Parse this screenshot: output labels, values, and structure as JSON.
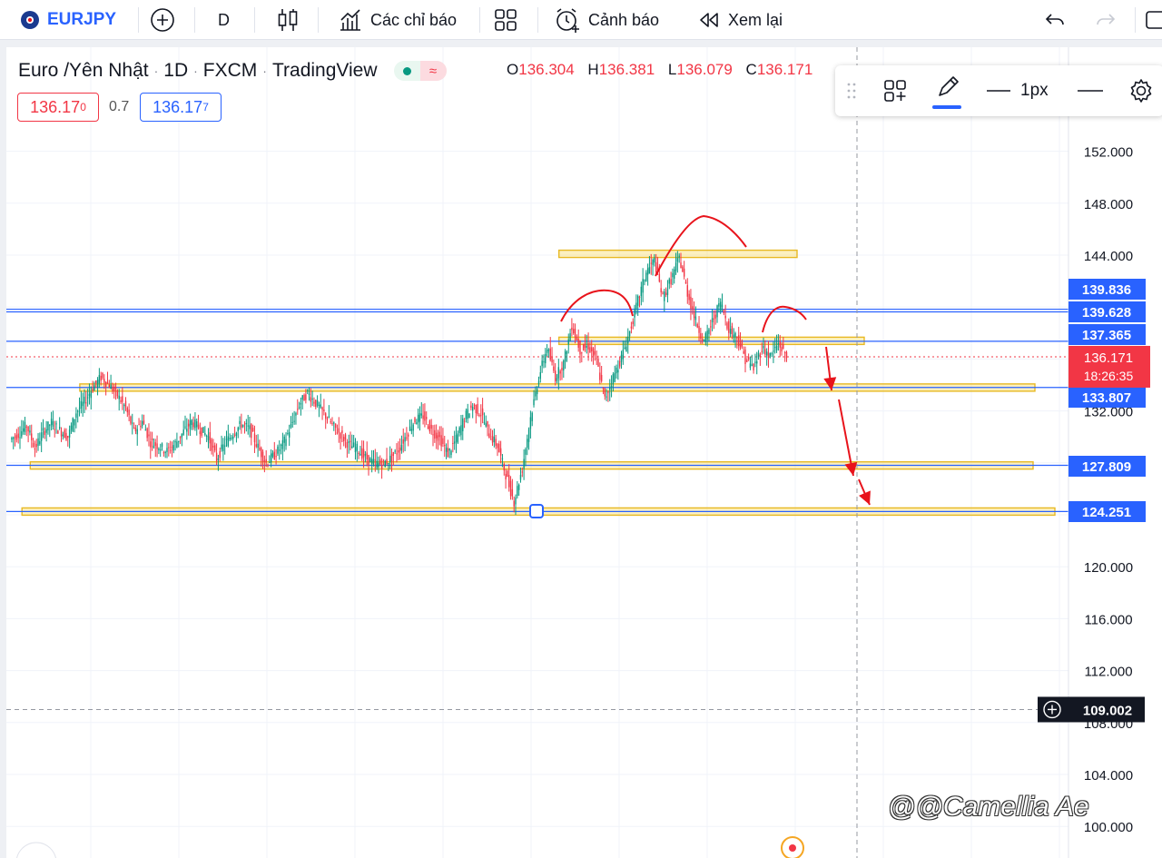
{
  "toolbar": {
    "symbol": "EURJPY",
    "interval": "D",
    "indicators_label": "Các chỉ báo",
    "alert_label": "Cảnh báo",
    "replay_label": "Xem lại"
  },
  "legend": {
    "title": "Euro /Yên Nhật",
    "interval": "1D",
    "source": "FXCM",
    "platform": "TradingView",
    "status_icon": "≈",
    "ohlc": {
      "o_key": "O",
      "o_val": "136.304",
      "h_key": "H",
      "h_val": "136.381",
      "l_key": "L",
      "l_val": "136.079",
      "c_key": "C",
      "c_val": "136.171"
    },
    "bid_main": "136.17",
    "bid_sup": "0",
    "spread": "0.7",
    "ask_main": "136.17",
    "ask_sup": "7"
  },
  "drawing_toolbar": {
    "line_width_label": "1px"
  },
  "colors": {
    "accent": "#2962ff",
    "up": "#089981",
    "down": "#f23645",
    "zone": "#f5d44a",
    "annotation": "#e8131b"
  },
  "chart_data": {
    "type": "candlestick",
    "symbol": "EURJPY",
    "timeframe": "1D",
    "ylim": [
      99,
      155
    ],
    "y_ticks": [
      "100.000",
      "104.000",
      "108.000",
      "112.000",
      "116.000",
      "120.000",
      "124.000",
      "128.000",
      "132.000",
      "136.000",
      "140.000",
      "144.000",
      "148.000",
      "152.000"
    ],
    "price_path": [
      129.8,
      130.2,
      130.9,
      129.1,
      130.4,
      131.1,
      130.5,
      130.0,
      131.9,
      132.7,
      133.8,
      134.6,
      134.0,
      133.2,
      132.2,
      130.4,
      131.2,
      129.6,
      129.3,
      128.9,
      129.5,
      130.4,
      131.2,
      130.6,
      130.0,
      128.3,
      129.5,
      130.3,
      131.0,
      130.6,
      129.2,
      128.0,
      128.6,
      129.4,
      130.8,
      132.5,
      133.4,
      132.6,
      131.8,
      130.9,
      130.2,
      129.4,
      129.1,
      128.4,
      128.0,
      127.9,
      128.3,
      129.0,
      130.2,
      131.3,
      131.6,
      130.5,
      129.9,
      128.7,
      129.8,
      131.5,
      132.4,
      131.8,
      130.2,
      129.3,
      127.1,
      125.0,
      127.6,
      131.5,
      134.6,
      136.9,
      134.6,
      135.7,
      138.6,
      136.7,
      137.0,
      135.8,
      132.9,
      134.6,
      136.1,
      138.1,
      140.5,
      142.7,
      143.6,
      140.7,
      142.1,
      143.8,
      141.1,
      138.9,
      137.3,
      138.9,
      140.4,
      138.3,
      137.7,
      136.0,
      135.3,
      136.9,
      136.2,
      137.2,
      136.171
    ],
    "current_price": {
      "value": "136.171",
      "countdown": "18:26:35"
    },
    "horizontal_lines": [
      {
        "price": 139.836,
        "label": "139.836"
      },
      {
        "price": 139.628,
        "label": "139.628"
      },
      {
        "price": 137.365,
        "label": "137.365"
      },
      {
        "price": 133.807,
        "label": "133.807"
      },
      {
        "price": 127.809,
        "label": "127.809"
      },
      {
        "price": 124.251,
        "label": "124.251"
      }
    ],
    "zones": [
      {
        "price": 144.1,
        "from_index": 67,
        "to_index": 94
      },
      {
        "price": 137.4,
        "from_index": 67,
        "to_index": 94
      },
      {
        "price": 133.8,
        "from_index": 9,
        "to_index": 94
      },
      {
        "price": 127.8,
        "from_index": 3,
        "to_index": 94
      },
      {
        "price": 124.25,
        "from_index": 2,
        "to_index": 94
      }
    ],
    "crosshair": {
      "price": "109.002"
    },
    "annotations": [
      "head-and-shoulders arcs",
      "downward arrows"
    ]
  },
  "watermark": "@@Camellia Ae"
}
